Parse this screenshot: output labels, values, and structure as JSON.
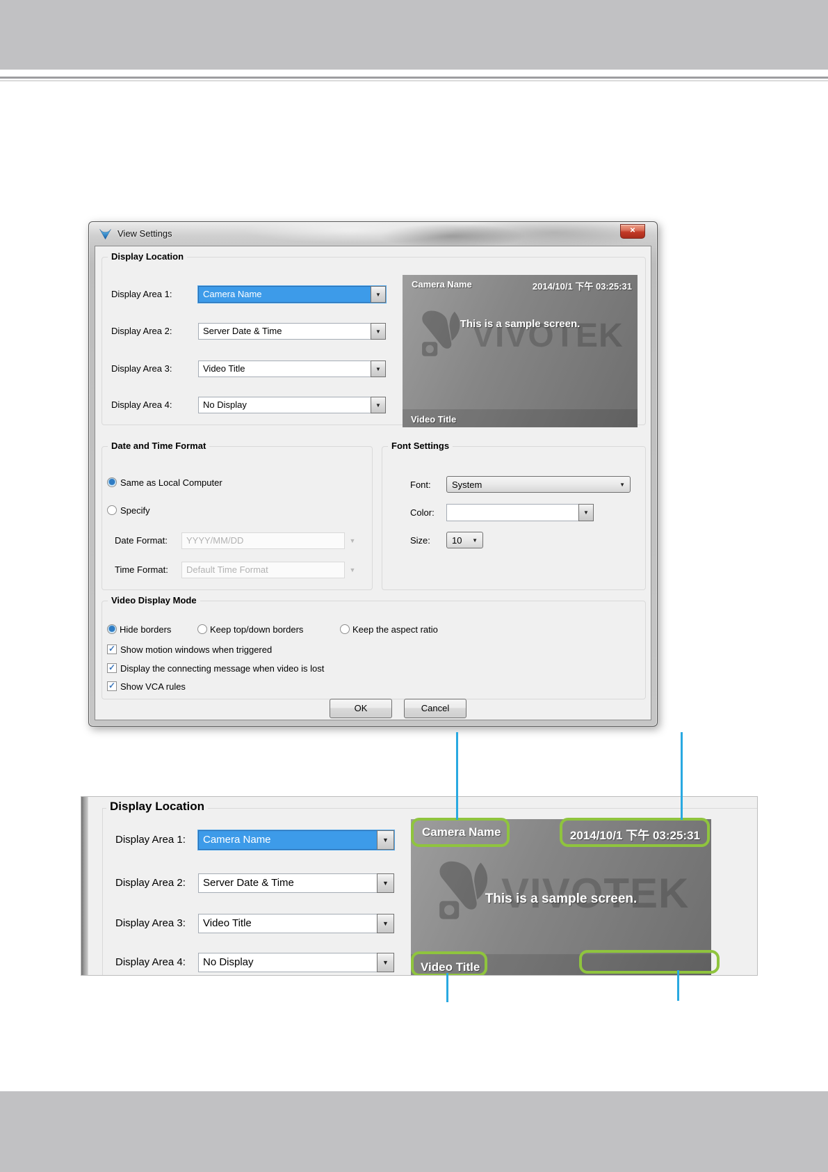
{
  "colors": {
    "band_gray": "#c1c1c3",
    "highlight_green": "#8fc43e",
    "callout_blue": "#29a9e1",
    "selection_blue": "#3d9be9"
  },
  "icons": {
    "close": "✕",
    "dropdown_arrow": "▼",
    "check": "✓"
  },
  "dialog": {
    "title": "View Settings",
    "display_location": {
      "label": "Display Location",
      "rows": [
        {
          "label": "Display Area 1:",
          "value": "Camera Name"
        },
        {
          "label": "Display Area 2:",
          "value": "Server Date & Time"
        },
        {
          "label": "Display Area 3:",
          "value": "Video Title"
        },
        {
          "label": "Display Area 4:",
          "value": "No Display"
        }
      ]
    },
    "preview": {
      "camera_name": "Camera Name",
      "datetime": "2014/10/1 下午 03:25:31",
      "sample_text": "This is a sample screen.",
      "video_title": "Video Title",
      "watermark_text": "VIVOTEK"
    },
    "date_time_format": {
      "label": "Date and Time Format",
      "radio_same": "Same as Local Computer",
      "radio_specify": "Specify",
      "date_format_label": "Date Format:",
      "date_format_value": "YYYY/MM/DD",
      "time_format_label": "Time Format:",
      "time_format_value": "Default Time Format"
    },
    "font_settings": {
      "label": "Font Settings",
      "font_label": "Font:",
      "font_value": "System",
      "color_label": "Color:",
      "color_value": "",
      "size_label": "Size:",
      "size_value": "10"
    },
    "video_display_mode": {
      "label": "Video Display Mode",
      "radios": [
        "Hide borders",
        "Keep top/down borders",
        "Keep the aspect ratio"
      ],
      "checkboxes": [
        "Show motion windows when triggered",
        "Display the connecting message when video is lost",
        "Show VCA rules"
      ]
    },
    "ok_label": "OK",
    "cancel_label": "Cancel"
  }
}
